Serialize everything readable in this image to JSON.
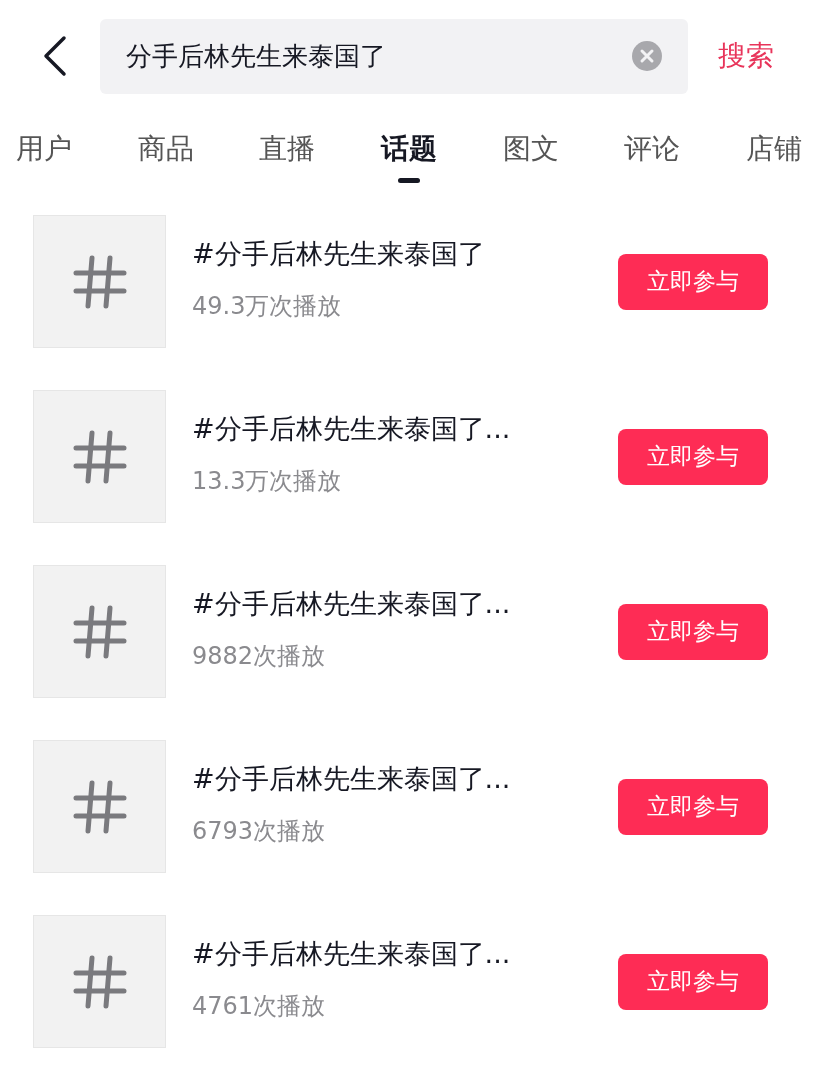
{
  "search": {
    "value": "分手后林先生来泰国了",
    "submit": "搜索"
  },
  "tabs": [
    {
      "label": "用户",
      "selected": false
    },
    {
      "label": "商品",
      "selected": false
    },
    {
      "label": "直播",
      "selected": false
    },
    {
      "label": "话题",
      "selected": true
    },
    {
      "label": "图文",
      "selected": false
    },
    {
      "label": "评论",
      "selected": false
    },
    {
      "label": "店铺",
      "selected": false
    }
  ],
  "topics": [
    {
      "title": "#分手后林先生来泰国了",
      "plays": "49.3万次播放",
      "action": "立即参与"
    },
    {
      "title": "#分手后林先生来泰国了...",
      "plays": "13.3万次播放",
      "action": "立即参与"
    },
    {
      "title": "#分手后林先生来泰国了...",
      "plays": "9882次播放",
      "action": "立即参与"
    },
    {
      "title": "#分手后林先生来泰国了...",
      "plays": "6793次播放",
      "action": "立即参与"
    },
    {
      "title": "#分手后林先生来泰国了...",
      "plays": "4761次播放",
      "action": "立即参与"
    }
  ]
}
